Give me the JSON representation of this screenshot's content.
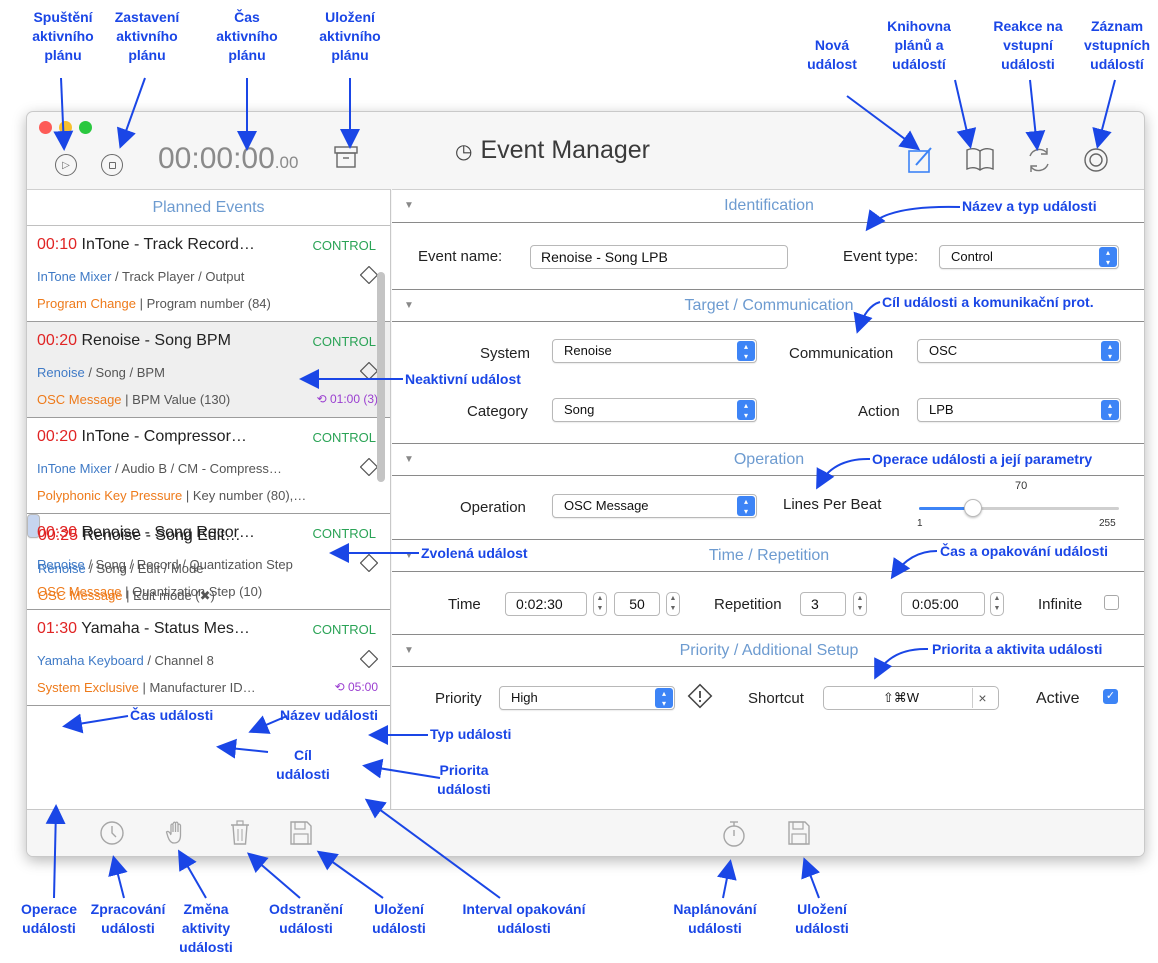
{
  "app": {
    "title": "Event Manager",
    "timer_main": "00:00:00",
    "timer_frac": ".00"
  },
  "left_panel": {
    "header": "Planned Events",
    "events": [
      {
        "time": "00:10",
        "name": "InTone - Track Record…",
        "type": "CONTROL",
        "target_sys": "InTone Mixer",
        "target_path": " / Track Player / Output",
        "op": "Program Change",
        "params": " | Program number (84)",
        "repeat": "",
        "state": "normal"
      },
      {
        "time": "00:20",
        "name": "Renoise - Song BPM",
        "type": "CONTROL",
        "target_sys": "Renoise",
        "target_path": " / Song / BPM",
        "op": "OSC Message",
        "params": " | BPM Value (130)",
        "repeat": "01:00 (3)",
        "state": "inactive"
      },
      {
        "time": "00:20",
        "name": "InTone - Compressor…",
        "type": "CONTROL",
        "target_sys": "InTone Mixer",
        "target_path": " / Audio B / CM - Compress…",
        "op": "Polyphonic Key Pressure",
        "params": " | Key number (80),…",
        "repeat": "",
        "state": "normal"
      },
      {
        "time": "00:25",
        "name": "Renoise - Song Edit…",
        "type": "CONTROL",
        "target_sys": "Renoise",
        "target_path": " / Song / Edit / Mode",
        "op": "OSC Message",
        "params": " | Edit mode (✖)",
        "repeat": "",
        "state": "selected"
      },
      {
        "time": "00:30",
        "name": "Renoise - Song Recor…",
        "type": "CONTROL",
        "target_sys": "Renoise",
        "target_path": " / Song / Record / Quantization Step",
        "op": "OSC Message",
        "params": " | Quantization Step (10)",
        "repeat": "",
        "state": "normal"
      },
      {
        "time": "01:30",
        "name": "Yamaha - Status Mes…",
        "type": "CONTROL",
        "target_sys": "Yamaha Keyboard",
        "target_path": " / Channel 8",
        "op": "System Exclusive",
        "params": " | Manufacturer ID…",
        "repeat": "05:00",
        "state": "normal"
      }
    ]
  },
  "identification": {
    "title": "Identification",
    "event_name_label": "Event name:",
    "event_name_value": "Renoise - Song LPB",
    "event_type_label": "Event type:",
    "event_type_value": "Control"
  },
  "target": {
    "title": "Target / Communication",
    "system_label": "System",
    "system_value": "Renoise",
    "communication_label": "Communication",
    "communication_value": "OSC",
    "category_label": "Category",
    "category_value": "Song",
    "action_label": "Action",
    "action_value": "LPB"
  },
  "operation": {
    "title": "Operation",
    "operation_label": "Operation",
    "operation_value": "OSC Message",
    "param_label": "Lines Per Beat",
    "slider_value": "70",
    "slider_min": "1",
    "slider_max": "255",
    "slider_fraction": 0.27
  },
  "time_rep": {
    "title": "Time / Repetition",
    "time_label": "Time",
    "time_value": "0:02:30",
    "frames_value": "50",
    "repetition_label": "Repetition",
    "repetition_value": "3",
    "interval_value": "0:05:00",
    "infinite_label": "Infinite"
  },
  "priority": {
    "title": "Priority / Additional Setup",
    "priority_label": "Priority",
    "priority_value": "High",
    "shortcut_label": "Shortcut",
    "shortcut_value": "⇧⌘W",
    "active_label": "Active"
  },
  "annotations": {
    "run_plan": "Spuštění\naktivního\nplánu",
    "stop_plan": "Zastavení\naktivního\nplánu",
    "plan_time": "Čas\naktivního\nplánu",
    "save_plan": "Uložení\naktivního\nplánu",
    "new_event": "Nová\nudálost",
    "library": "Knihovna\nplánů a\nudálostí",
    "input_reaction": "Reakce na\nvstupní\nudálosti",
    "input_record": "Záznam\nvstupních\nudálostí",
    "name_type": "Název a typ události",
    "target_comm": "Cíl události a komunikační prot.",
    "inactive_event": "Neaktivní událost",
    "operation_params": "Operace události a její parametry",
    "selected_event": "Zvolená událost",
    "time_repeat": "Čas a opakování události",
    "priority_activity": "Priorita a aktivita události",
    "event_time": "Čas události",
    "event_name": "Název události",
    "event_type": "Typ události",
    "event_target": "Cíl\nudálosti",
    "event_priority": "Priorita\nudálosti",
    "event_operation": "Operace\nudálosti",
    "processing": "Zpracování\nudálosti",
    "change_activity": "Změna\naktivity\nudálosti",
    "remove_event": "Odstranění\nudálosti",
    "save_event": "Uložení\nudálosti",
    "repeat_interval": "Interval opakování\nudálosti",
    "schedule_event": "Naplánování\nudálosti",
    "save_event2": "Uložení\nudálosti"
  }
}
